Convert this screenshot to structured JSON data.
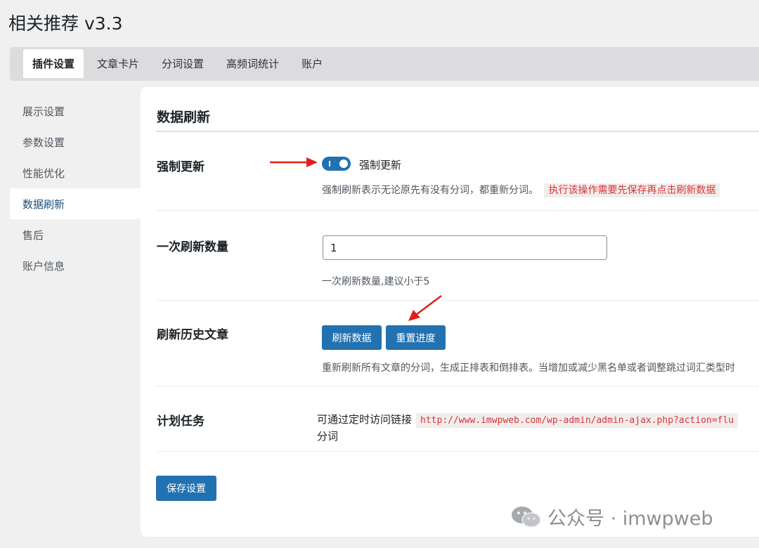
{
  "app": {
    "title": "相关推荐 v3.3"
  },
  "tabs": [
    "插件设置",
    "文章卡片",
    "分词设置",
    "高频词统计",
    "账户"
  ],
  "sidebar": {
    "items": [
      "展示设置",
      "参数设置",
      "性能优化",
      "数据刷新",
      "售后",
      "账户信息"
    ],
    "active_index": 3
  },
  "section": {
    "title": "数据刷新"
  },
  "force_update": {
    "label": "强制更新",
    "toggle_label": "强制更新",
    "toggle_on": true,
    "description": "强制刷新表示无论原先有没有分词，都重新分词。",
    "warning": "执行该操作需要先保存再点击刷新数据"
  },
  "batch_count": {
    "label": "一次刷新数量",
    "value": "1",
    "description": "一次刷新数量,建议小于5"
  },
  "refresh_history": {
    "label": "刷新历史文章",
    "refresh_button": "刷新数据",
    "reset_button": "重置进度",
    "description": "重新刷新所有文章的分词，生成正排表和倒排表。当增加或减少黑名单或者调整跳过词汇类型时"
  },
  "cron": {
    "label": "计划任务",
    "text_before": "可通过定时访问链接",
    "url": "http://www.imwpweb.com/wp-admin/admin-ajax.php?action=flu",
    "text_after": "分词"
  },
  "save_button": "保存设置",
  "watermark": {
    "text": "公众号 · imwpweb"
  },
  "colors": {
    "accent": "#2271b1",
    "annotation_arrow": "#e0201c",
    "warning_text": "#d63638"
  }
}
